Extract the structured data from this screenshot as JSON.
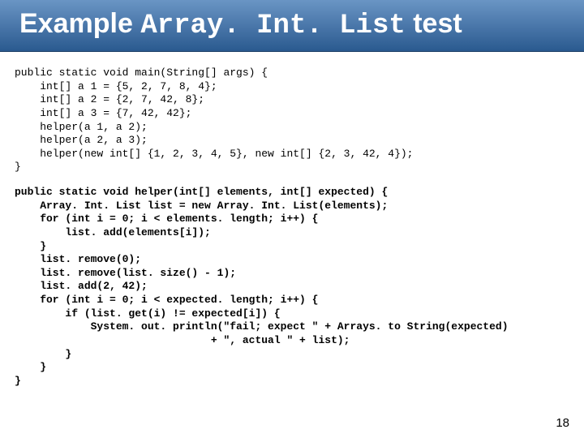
{
  "title": {
    "part1": "Example ",
    "part2": "Array. Int. List",
    "part3": " test"
  },
  "code_block_1": "public static void main(String[] args) {\n    int[] a 1 = {5, 2, 7, 8, 4};\n    int[] a 2 = {2, 7, 42, 8};\n    int[] a 3 = {7, 42, 42};\n    helper(a 1, a 2);\n    helper(a 2, a 3);\n    helper(new int[] {1, 2, 3, 4, 5}, new int[] {2, 3, 42, 4});\n}",
  "code_block_2": "public static void helper(int[] elements, int[] expected) {\n    Array. Int. List list = new Array. Int. List(elements);\n    for (int i = 0; i < elements. length; i++) {\n        list. add(elements[i]);\n    }\n    list. remove(0);\n    list. remove(list. size() - 1);\n    list. add(2, 42);\n    for (int i = 0; i < expected. length; i++) {\n        if (list. get(i) != expected[i]) {\n            System. out. println(\"fail; expect \" + Arrays. to String(expected)\n                               + \", actual \" + list);\n        }\n    }\n}",
  "page_number": "18"
}
